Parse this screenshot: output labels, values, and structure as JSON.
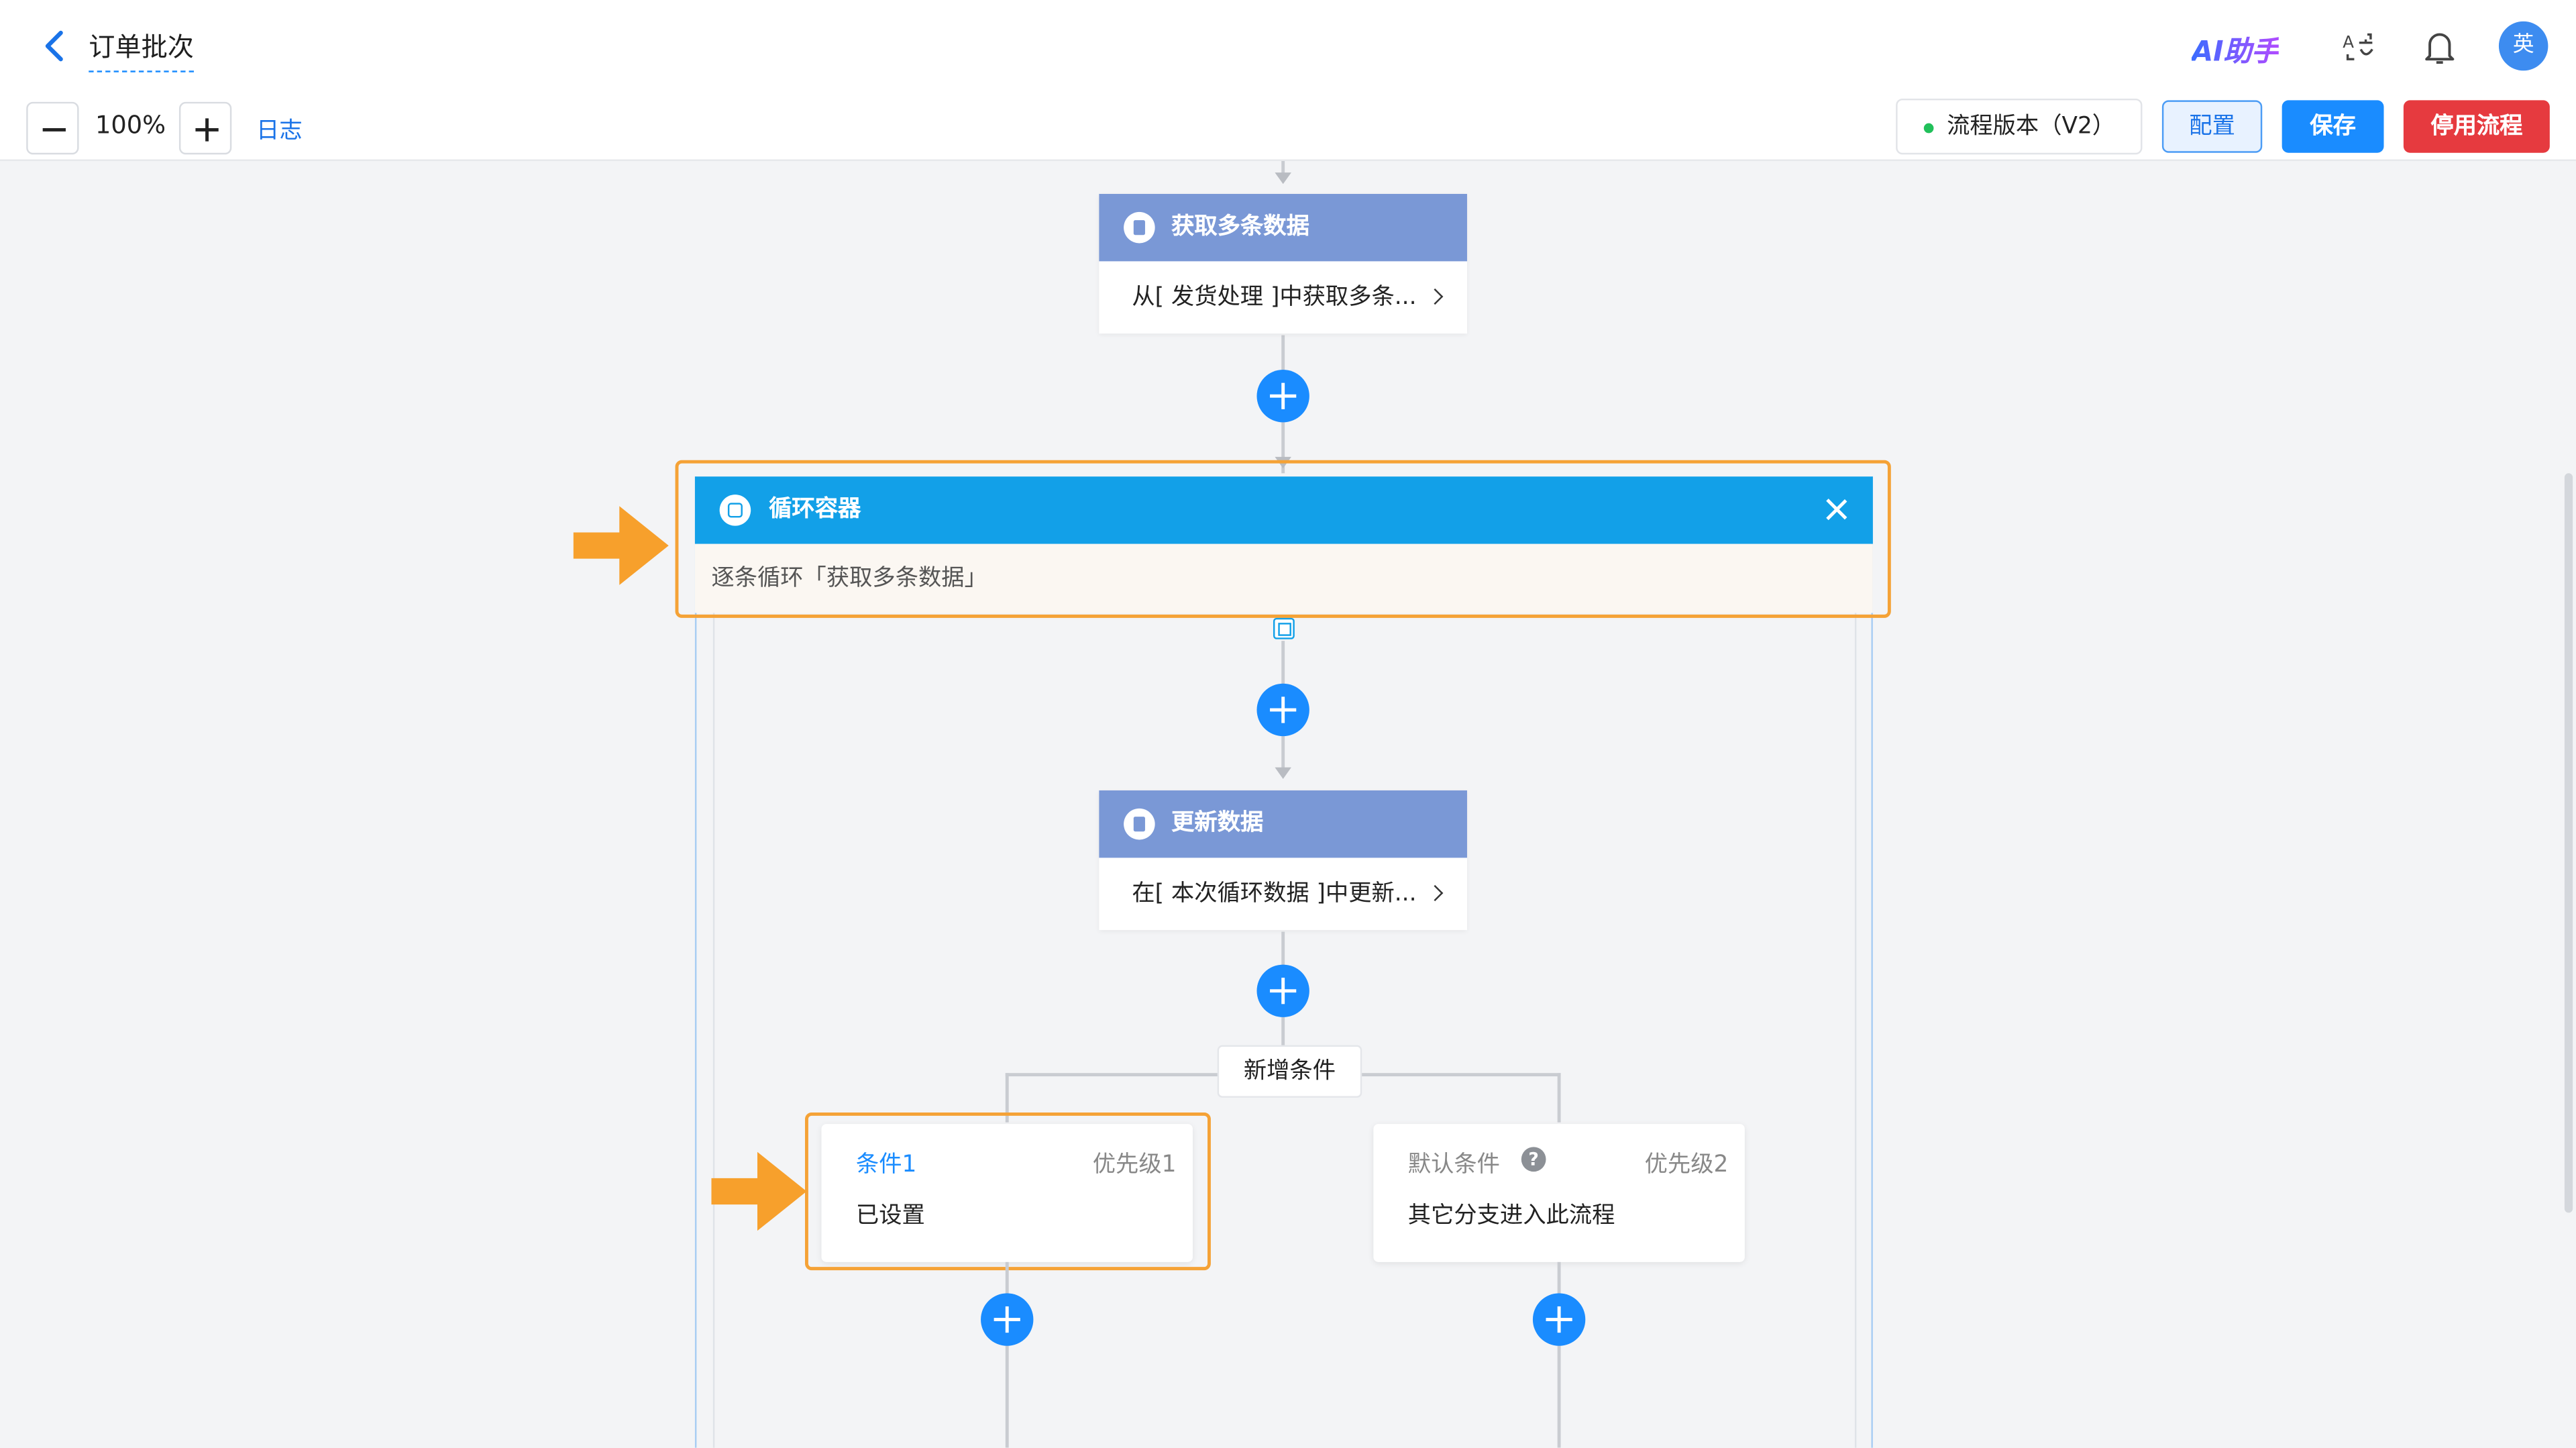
{
  "header": {
    "title": "订单批次",
    "ai_helper": "AI助手",
    "avatar": "英"
  },
  "toolbar": {
    "zoom_level": "100%",
    "log_link": "日志",
    "version_label": "流程版本（V2）",
    "config_label": "配置",
    "save_label": "保存",
    "disable_label": "停用流程"
  },
  "flow": {
    "get_data_node": {
      "title": "获取多条数据",
      "body": "从[ 发货处理 ]中获取多条..."
    },
    "loop_container": {
      "title": "循环容器",
      "description": "逐条循环「获取多条数据」"
    },
    "update_node": {
      "title": "更新数据",
      "body": "在[ 本次循环数据 ]中更新..."
    },
    "add_condition": "新增条件",
    "conditions": [
      {
        "title": "条件1",
        "priority": "优先级1",
        "body": "已设置"
      },
      {
        "title": "默认条件",
        "priority": "优先级2",
        "body": "其它分支进入此流程"
      }
    ]
  },
  "colors": {
    "primary": "#1a8cff",
    "node_header": "#7a98d6",
    "loop_header": "#12a0e8",
    "highlight": "#f5a236",
    "danger": "#e63a3f",
    "status_dot": "#21c05a"
  },
  "icons": [
    "back-arrow-icon",
    "translate-icon",
    "bell-icon",
    "minus-icon",
    "plus-icon",
    "document-icon",
    "loop-icon",
    "close-icon",
    "chevron-right-icon",
    "help-icon",
    "orange-arrow-icon"
  ]
}
